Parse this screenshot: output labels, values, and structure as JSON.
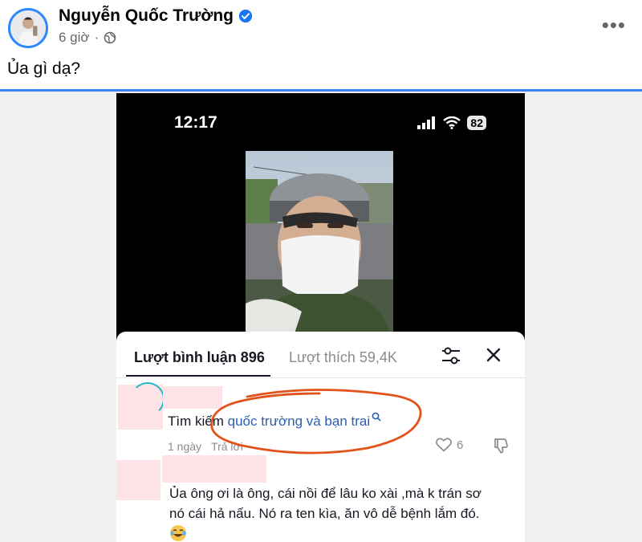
{
  "post": {
    "author": "Nguyễn Quốc Trường",
    "time": "6 giờ",
    "caption": "Ủa gì dạ?",
    "more": "•••"
  },
  "phone": {
    "time": "12:17",
    "battery": "82"
  },
  "comments_sheet": {
    "tab_comments": "Lượt bình luận 896",
    "tab_likes": "Lượt thích 59,4K"
  },
  "comment1": {
    "prefix": "Tìm kiếm ",
    "search_query": "quốc trường và bạn trai",
    "time": "1 ngày",
    "reply": "Trả lời",
    "likes": "6"
  },
  "comment2": {
    "line1": "Ủa ông ơi là ông, cái nồi để lâu ko xài ,mà k trán sơ",
    "line2": "nó cái hả nấu. Nó ra ten kìa, ăn vô dễ bệnh lắm đó."
  },
  "colors": {
    "accent_blue": "#3b82f6",
    "verified": "#1877f2",
    "annotation_orange": "#e2531c",
    "link_blue": "#2b5fb4",
    "blur_pink": "#fde2e6"
  },
  "icons": [
    "verified-icon",
    "globe-icon",
    "more-icon",
    "signal-icon",
    "wifi-icon",
    "battery-icon",
    "filter-icon",
    "close-icon",
    "search-icon",
    "heart-icon",
    "dislike-icon",
    "laughing-emoji"
  ]
}
